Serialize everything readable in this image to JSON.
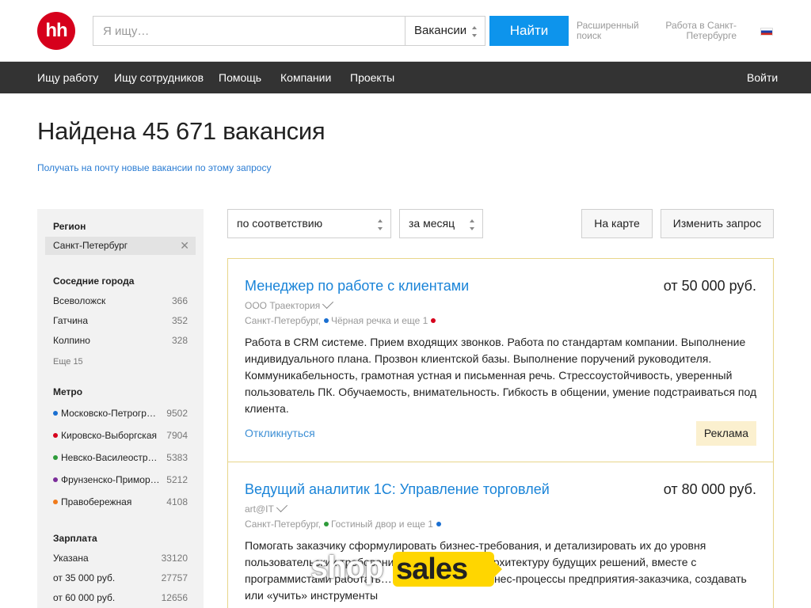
{
  "header": {
    "logo_text": "hh",
    "search_placeholder": "Я ищу…",
    "search_type": "Вакансии",
    "search_button": "Найти",
    "advanced_search": "Расширенный поиск",
    "region_link": "Работа в Санкт-Петербурге"
  },
  "nav": {
    "items": [
      "Ищу работу",
      "Ищу сотрудников",
      "Помощь",
      "Компании",
      "Проекты"
    ],
    "login": "Войти"
  },
  "main": {
    "title": "Найдена 45 671 вакансия",
    "subscribe": "Получать на почту новые вакансии по этому запросу"
  },
  "sidebar": {
    "region_heading": "Регион",
    "region_value": "Санкт-Петербург",
    "nearby_heading": "Соседние города",
    "nearby": [
      {
        "name": "Всеволожск",
        "count": "366"
      },
      {
        "name": "Гатчина",
        "count": "352"
      },
      {
        "name": "Колпино",
        "count": "328"
      }
    ],
    "nearby_more": "Еще 15",
    "metro_heading": "Метро",
    "metro": [
      {
        "name": "Московско-Петрогр…",
        "count": "9502",
        "color": "#1a6fd1"
      },
      {
        "name": "Кировско-Выборгская",
        "count": "7904",
        "color": "#d6001c"
      },
      {
        "name": "Невско-Василеостр…",
        "count": "5383",
        "color": "#2e9b3a"
      },
      {
        "name": "Фрунзенско-Примор…",
        "count": "5212",
        "color": "#7b2d9a"
      },
      {
        "name": "Правобережная",
        "count": "4108",
        "color": "#f07a1a"
      }
    ],
    "salary_heading": "Зарплата",
    "salary": [
      {
        "name": "Указана",
        "count": "33120"
      },
      {
        "name": "от 35 000 руб.",
        "count": "27757"
      },
      {
        "name": "от 60 000 руб.",
        "count": "12656"
      }
    ]
  },
  "controls": {
    "sort": "по соответствию",
    "period": "за месяц",
    "map": "На карте",
    "edit": "Изменить запрос"
  },
  "vacancies": [
    {
      "title": "Менеджер по работе с клиентами",
      "salary": "от 50 000 руб.",
      "company": "ООО Траектория",
      "city": "Санкт-Петербург,",
      "metro": "Чёрная речка и еще 1",
      "metro_color": "#1a6fd1",
      "extra_color": "#d6001c",
      "description": "Работа в CRM системе. Прием входящих звонков. Работа по стандартам компании. Выполнение индивидуального плана. Прозвон клиентской базы. Выполнение поручений руководителя. Коммуникабельность, грамотная устная и письменная речь. Стрессоустойчивость, уверенный пользователь ПК. Обучаемость, внимательность. Гибкость в общении, умение подстраиваться под клиента.",
      "respond": "Откликнуться",
      "ad": "Реклама"
    },
    {
      "title": "Ведущий аналитик 1С: Управление торговлей",
      "salary": "от 80 000 руб.",
      "company": "art@IT",
      "city": "Санкт-Петербург,",
      "metro": "Гостиный двор и еще 1",
      "metro_color": "#2e9b3a",
      "extra_color": "#1a6fd1",
      "description": "Помогать заказчику сформулировать бизнес-требования, и детализировать их до уровня пользовательских требований. Проектировать архитектуру будущих решений, вместе с программистами работать… Анализировать бизнес-процессы предприятия-заказчика, создавать или «учить» инструменты"
    }
  ],
  "watermark": {
    "shop": "shop",
    "sales": "sales"
  }
}
